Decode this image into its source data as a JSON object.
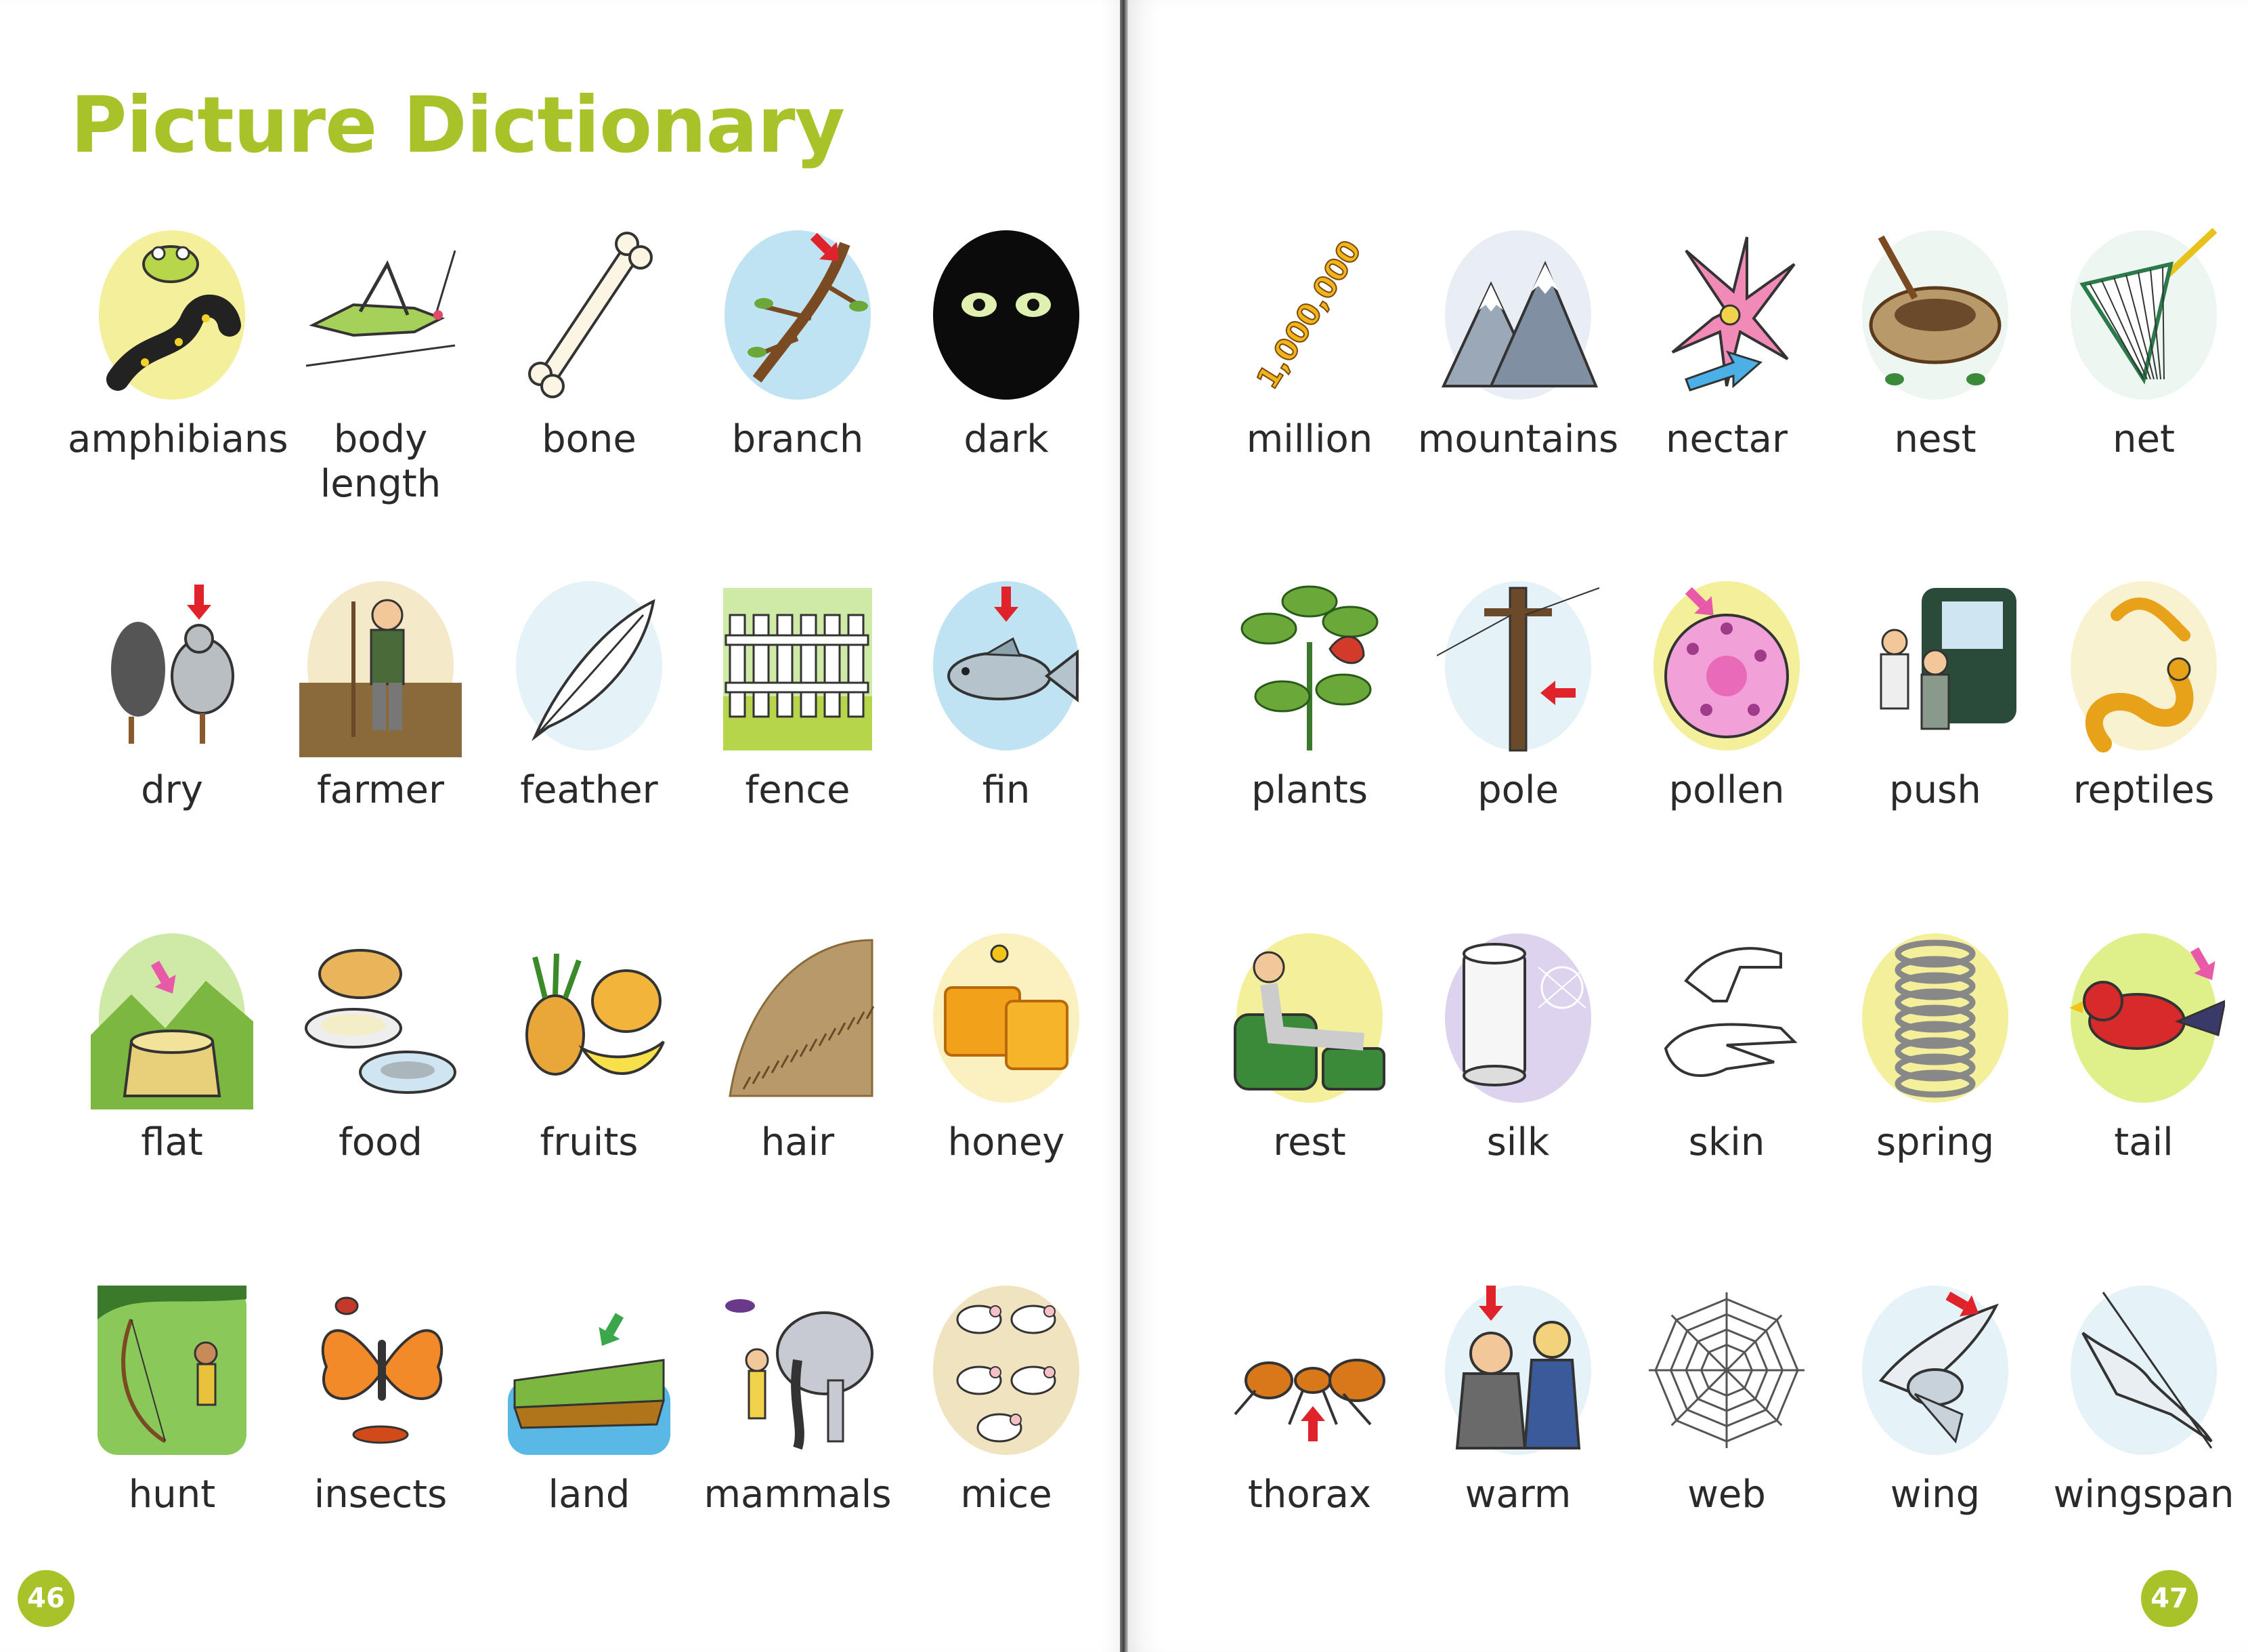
{
  "title": "Picture Dictionary",
  "accent_color": "#a8c22a",
  "pages": {
    "left_number": "46",
    "right_number": "47"
  },
  "left_words": [
    {
      "label": "amphibians",
      "icon": "amphibians-icon"
    },
    {
      "label": "body length",
      "icon": "grasshopper-icon"
    },
    {
      "label": "bone",
      "icon": "bone-icon"
    },
    {
      "label": "branch",
      "icon": "branch-icon"
    },
    {
      "label": "dark",
      "icon": "eyes-in-dark-icon"
    },
    {
      "label": "dry",
      "icon": "wet-and-dry-bird-icon"
    },
    {
      "label": "farmer",
      "icon": "farmer-icon"
    },
    {
      "label": "feather",
      "icon": "feather-icon"
    },
    {
      "label": "fence",
      "icon": "fence-icon"
    },
    {
      "label": "fin",
      "icon": "fish-fin-icon"
    },
    {
      "label": "flat",
      "icon": "tree-stump-icon"
    },
    {
      "label": "food",
      "icon": "food-plates-icon"
    },
    {
      "label": "fruits",
      "icon": "fruits-icon"
    },
    {
      "label": "hair",
      "icon": "hair-icon"
    },
    {
      "label": "honey",
      "icon": "honeycomb-icon"
    },
    {
      "label": "hunt",
      "icon": "hunter-icon"
    },
    {
      "label": "insects",
      "icon": "insects-icon"
    },
    {
      "label": "land",
      "icon": "land-icon"
    },
    {
      "label": "mammals",
      "icon": "mammals-icon"
    },
    {
      "label": "mice",
      "icon": "mice-icon"
    }
  ],
  "right_words": [
    {
      "label": "million",
      "icon": "million-number-icon"
    },
    {
      "label": "mountains",
      "icon": "mountains-icon"
    },
    {
      "label": "nectar",
      "icon": "flower-nectar-icon"
    },
    {
      "label": "nest",
      "icon": "nest-icon"
    },
    {
      "label": "net",
      "icon": "net-icon"
    },
    {
      "label": "plants",
      "icon": "plants-icon"
    },
    {
      "label": "pole",
      "icon": "pole-icon"
    },
    {
      "label": "pollen",
      "icon": "pollen-flower-icon"
    },
    {
      "label": "push",
      "icon": "push-car-icon"
    },
    {
      "label": "reptiles",
      "icon": "reptiles-icon"
    },
    {
      "label": "rest",
      "icon": "resting-woman-icon"
    },
    {
      "label": "silk",
      "icon": "silk-spool-icon"
    },
    {
      "label": "skin",
      "icon": "hands-skin-icon"
    },
    {
      "label": "spring",
      "icon": "spring-coil-icon"
    },
    {
      "label": "tail",
      "icon": "bird-tail-icon"
    },
    {
      "label": "thorax",
      "icon": "ant-thorax-icon"
    },
    {
      "label": "warm",
      "icon": "warm-clothes-icon"
    },
    {
      "label": "web",
      "icon": "spider-web-icon"
    },
    {
      "label": "wing",
      "icon": "bird-wing-icon"
    },
    {
      "label": "wingspan",
      "icon": "bird-wingspan-icon"
    }
  ],
  "million_text": "1,000,000"
}
